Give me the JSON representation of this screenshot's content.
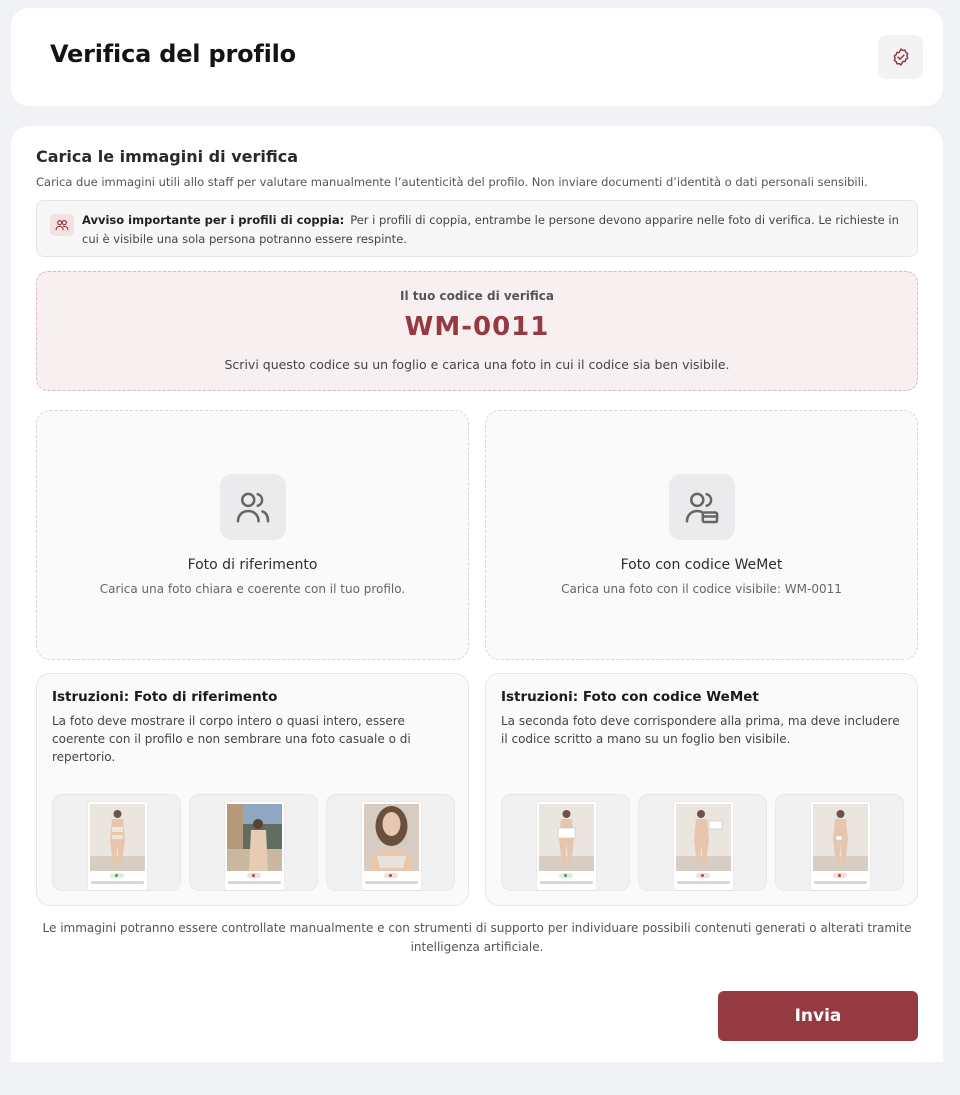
{
  "header": {
    "title": "Verifica del profilo",
    "badge_icon": "verified-badge-icon"
  },
  "upload_section": {
    "title": "Carica le immagini di verifica",
    "description": "Carica due immagini utili allo staff per valutare manualmente l’autenticità del profilo. Non inviare documenti d’identità o dati personali sensibili."
  },
  "notice": {
    "icon": "couple-icon",
    "title": "Avviso importante per i profili di coppia:",
    "text": "Per i profili di coppia, entrambe le persone devono apparire nelle foto di verifica. Le richieste in cui è visibile una sola persona potranno essere respinte."
  },
  "code": {
    "label": "Il tuo codice di verifica",
    "value": "WM-0011",
    "hint": "Scrivi questo codice su un foglio e carica una foto in cui il codice sia ben visibile."
  },
  "uploads": [
    {
      "icon": "users-icon",
      "title": "Foto di riferimento",
      "description": "Carica una foto chiara e coerente con il tuo profilo."
    },
    {
      "icon": "users-card-icon",
      "title": "Foto con codice WeMet",
      "description": "Carica una foto con il codice visibile: WM-0011"
    }
  ],
  "instructions": [
    {
      "title": "Istruzioni: Foto di riferimento",
      "text": "La foto deve mostrare il corpo intero o quasi intero, essere coerente con il profilo e non sembrare una foto casuale o di repertorio.",
      "examples": [
        "ok",
        "no",
        "no"
      ]
    },
    {
      "title": "Istruzioni: Foto con codice WeMet",
      "text": "La seconda foto deve corrispondere alla prima, ma deve includere il codice scritto a mano su un foglio ben visibile.",
      "examples": [
        "ok",
        "no",
        "no"
      ]
    }
  ],
  "footnote": "Le immagini potranno essere controllate manualmente e con strumenti di supporto per individuare possibili contenuti generati o alterati tramite intelligenza artificiale.",
  "submit_label": "Invia",
  "colors": {
    "accent": "#963a42",
    "code_bg": "#f8eff1",
    "page_bg": "#f1f2f5"
  }
}
